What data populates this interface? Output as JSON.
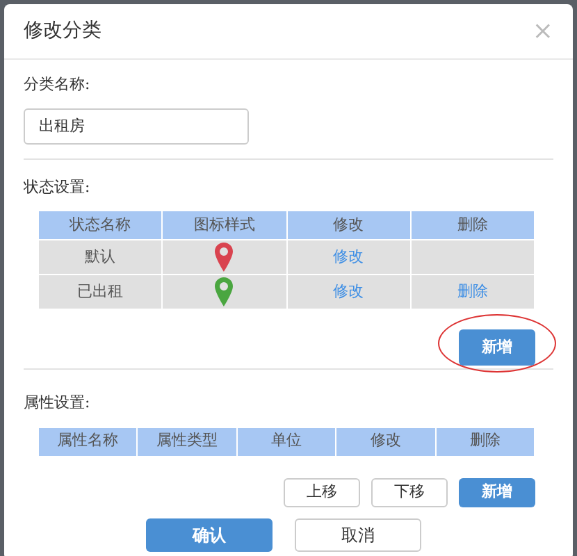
{
  "dialog": {
    "title": "修改分类",
    "close": "×"
  },
  "category_name": {
    "label": "分类名称:",
    "value": "出租房"
  },
  "status_settings": {
    "label": "状态设置:",
    "columns": [
      "状态名称",
      "图标样式",
      "修改",
      "删除"
    ],
    "rows": [
      {
        "name": "默认",
        "color": "#d9434f",
        "edit": "修改"
      },
      {
        "name": "已出租",
        "color": "#4aa640",
        "edit": "修改",
        "delete": "删除"
      }
    ],
    "add_button": {
      "label": "新增",
      "highlighted": true
    }
  },
  "attribute_settings": {
    "label": "属性设置:",
    "columns": [
      "属性名称",
      "属性类型",
      "单位",
      "修改",
      "删除"
    ],
    "buttons": [
      {
        "label": "上移",
        "kind": "outline"
      },
      {
        "label": "下移",
        "kind": "outline"
      },
      {
        "label": "新增",
        "kind": "primary"
      }
    ]
  },
  "footer_buttons": [
    {
      "label": "确认",
      "kind": "primary"
    },
    {
      "label": "取消",
      "kind": "outline"
    }
  ]
}
